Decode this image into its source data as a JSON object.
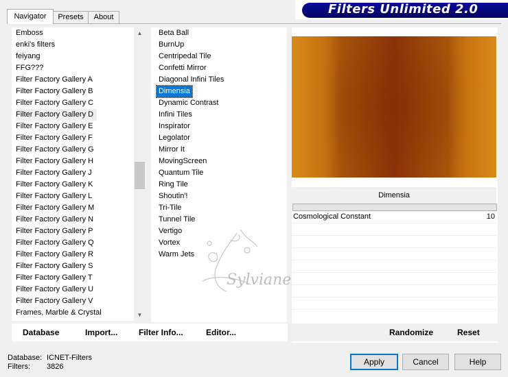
{
  "tabs": [
    {
      "label": "Navigator",
      "active": true
    },
    {
      "label": "Presets",
      "active": false
    },
    {
      "label": "About",
      "active": false
    }
  ],
  "title": "Filters Unlimited 2.0",
  "categories": [
    "Emboss",
    "enki's filters",
    "feiyang",
    "FFG???",
    "Filter Factory Gallery A",
    "Filter Factory Gallery B",
    "Filter Factory Gallery C",
    "Filter Factory Gallery D",
    "Filter Factory Gallery E",
    "Filter Factory Gallery F",
    "Filter Factory Gallery G",
    "Filter Factory Gallery H",
    "Filter Factory Gallery J",
    "Filter Factory Gallery K",
    "Filter Factory Gallery L",
    "Filter Factory Gallery M",
    "Filter Factory Gallery N",
    "Filter Factory Gallery P",
    "Filter Factory Gallery Q",
    "Filter Factory Gallery R",
    "Filter Factory Gallery S",
    "Filter Factory Gallery T",
    "Filter Factory Gallery U",
    "Filter Factory Gallery V",
    "Frames, Marble & Crystal"
  ],
  "selected_category": "Filter Factory Gallery D",
  "filters": [
    "Beta Ball",
    "BurnUp",
    "Centripedal Tile",
    "Confetti Mirror",
    "Diagonal Infini Tiles",
    "Dimensia",
    "Dynamic Contrast",
    "Infini Tiles",
    "Inspirator",
    "Legolator",
    "Mirror It",
    "MovingScreen",
    "Quantum Tile",
    "Ring Tile",
    "Shoutin'!",
    "Tri-Tile",
    "Tunnel Tile",
    "Vertigo",
    "Vortex",
    "Warm Jets"
  ],
  "selected_filter": "Dimensia",
  "list_buttons": {
    "database": "Database",
    "import": "Import...",
    "filter_info": "Filter Info...",
    "editor": "Editor..."
  },
  "parameters": {
    "heading": "Dimensia",
    "items": [
      {
        "label": "Cosmological Constant",
        "value": "10"
      }
    ]
  },
  "preview_buttons": {
    "randomize": "Randomize",
    "reset": "Reset"
  },
  "status": {
    "database_label": "Database:",
    "database_value": "ICNET-Filters",
    "filters_label": "Filters:",
    "filters_value": "3826"
  },
  "dialog_buttons": {
    "apply": "Apply",
    "cancel": "Cancel",
    "help": "Help"
  },
  "watermark_text": "Sylviane",
  "colors": {
    "selection": "#0078d7",
    "banner": "#06067e"
  }
}
